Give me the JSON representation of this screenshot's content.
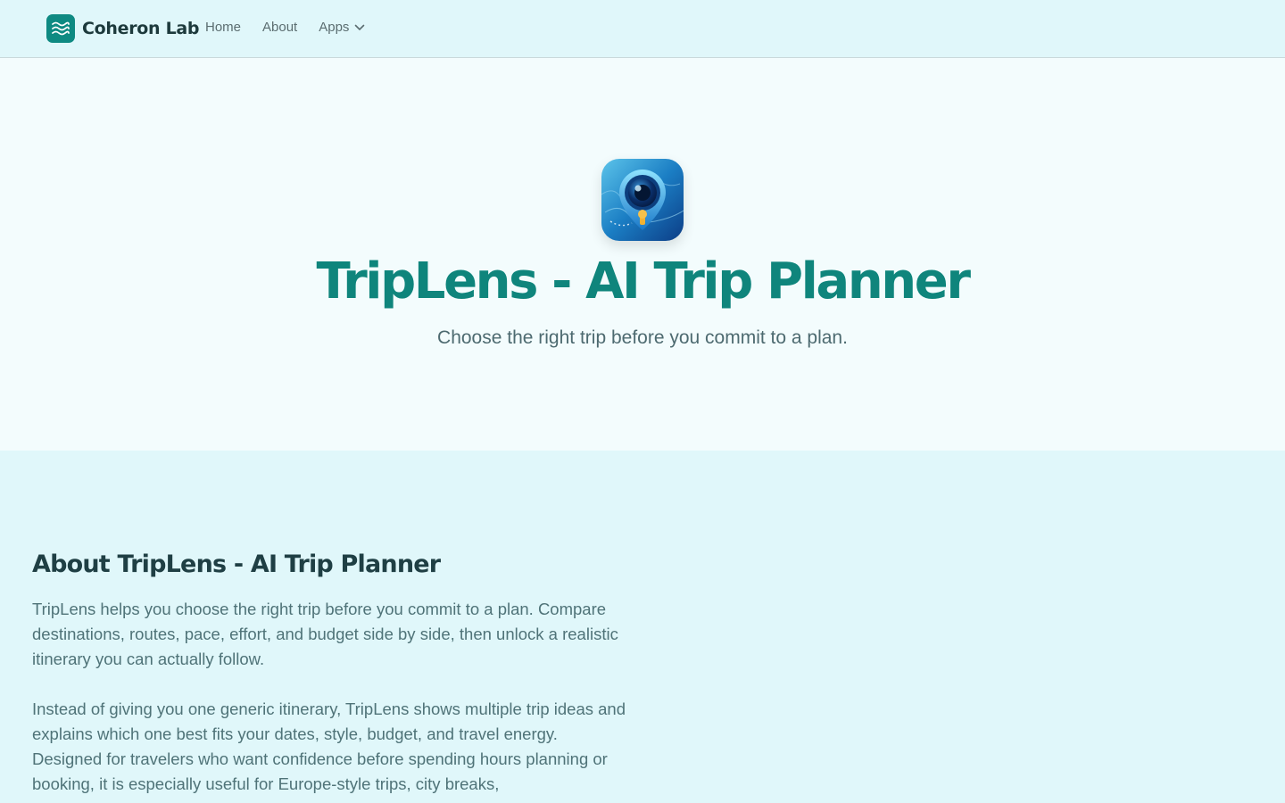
{
  "header": {
    "brand_name": "Coheron Lab",
    "nav": {
      "home": "Home",
      "about": "About",
      "apps": "Apps"
    }
  },
  "hero": {
    "title": "TripLens - AI Trip Planner",
    "tagline": "Choose the right trip before you commit to a plan."
  },
  "about": {
    "title": "About TripLens - AI Trip Planner",
    "paragraph_1": "TripLens helps you choose the right trip before you commit to a plan. Compare destinations, routes, pace, effort, and budget side by side, then unlock a realistic itinerary you can actually follow.",
    "paragraph_2": "Instead of giving you one generic itinerary, TripLens shows multiple trip ideas and explains which one best fits your dates, style, budget, and travel energy. Designed for travelers who want confidence before spending hours planning or booking, it is especially useful for Europe-style trips, city breaks,"
  },
  "colors": {
    "accent": "#0f857c",
    "header_bg": "#e0f7fa",
    "hero_bg": "#f3fcfd"
  },
  "icons": {
    "brand": "waves-icon",
    "apps_dropdown": "chevron-down-icon",
    "app": "triplens-app-icon"
  }
}
